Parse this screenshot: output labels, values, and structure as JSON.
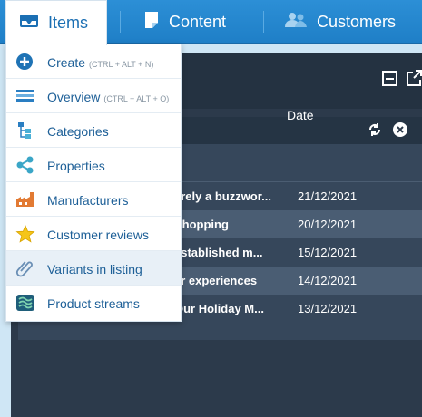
{
  "nav": {
    "items": "Items",
    "content": "Content",
    "customers": "Customers"
  },
  "menu": [
    {
      "label": "Create",
      "shortcut": "(CTRL + ALT + N)",
      "icon": "plus-circle-icon"
    },
    {
      "label": "Overview",
      "shortcut": "(CTRL + ALT + O)",
      "icon": "list-icon"
    },
    {
      "label": "Categories",
      "shortcut": "",
      "icon": "tree-icon"
    },
    {
      "label": "Properties",
      "shortcut": "",
      "icon": "share-icon"
    },
    {
      "label": "Manufacturers",
      "shortcut": "",
      "icon": "factory-icon"
    },
    {
      "label": "Customer reviews",
      "shortcut": "",
      "icon": "star-icon"
    },
    {
      "label": "Variants in listing",
      "shortcut": "",
      "icon": "paperclip-icon"
    },
    {
      "label": "Product streams",
      "shortcut": "",
      "icon": "streams-icon"
    }
  ],
  "table": {
    "date_header": "Date",
    "rows": [
      {
        "title": "erely a buzzwor...",
        "date": "21/12/2021"
      },
      {
        "title": "Shopping",
        "date": "20/12/2021"
      },
      {
        "title": "established m...",
        "date": "15/12/2021"
      },
      {
        "title": "er experiences",
        "date": "14/12/2021"
      },
      {
        "title": "Our Holiday M...",
        "date": "13/12/2021"
      }
    ]
  },
  "colors": {
    "topbar": "#2c8fd6",
    "window": "#2c3a4b",
    "menu_text": "#1d5f97"
  }
}
